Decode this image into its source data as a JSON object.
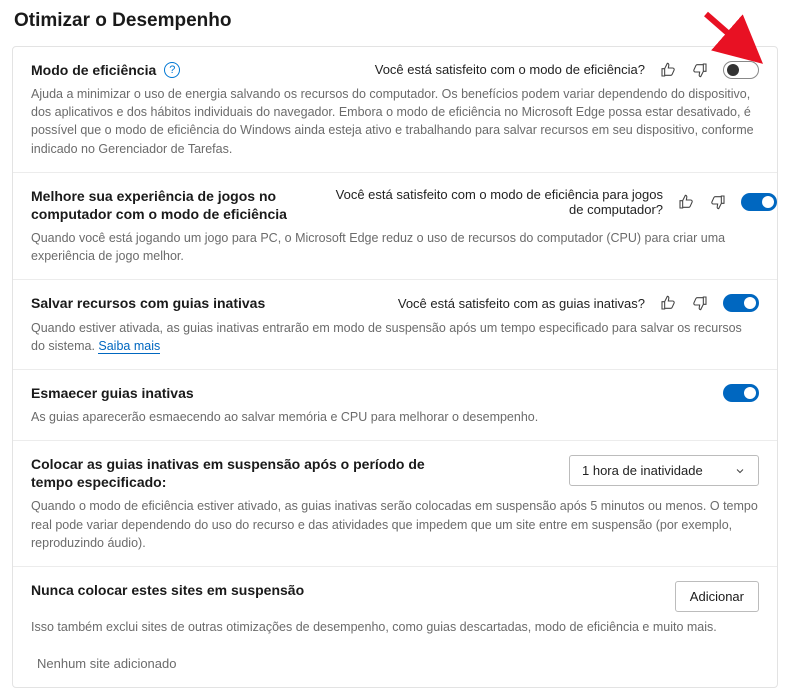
{
  "page_title": "Otimizar o Desempenho",
  "sections": {
    "efficiency": {
      "title": "Modo de eficiência",
      "prompt": "Você está satisfeito com o modo de eficiência?",
      "desc": "Ajuda a minimizar o uso de energia salvando os recursos do computador. Os benefícios podem variar dependendo do dispositivo, dos aplicativos e dos hábitos individuais do navegador. Embora o modo de eficiência no Microsoft Edge possa estar desativado, é possível que o modo de eficiência do Windows ainda esteja ativo e trabalhando para salvar recursos em seu dispositivo, conforme indicado no Gerenciador de Tarefas."
    },
    "gaming": {
      "title": "Melhore sua experiência de jogos no computador com o modo de eficiência",
      "prompt": "Você está satisfeito com o modo de eficiência para jogos de computador?",
      "desc": "Quando você está jogando um jogo para PC, o Microsoft Edge reduz o uso de recursos do computador (CPU) para criar uma experiência de jogo melhor."
    },
    "sleeping": {
      "title": "Salvar recursos com guias inativas",
      "prompt": "Você está satisfeito com as guias inativas?",
      "desc": "Quando estiver ativada, as guias inativas entrarão em modo de suspensão após um tempo especificado para salvar os recursos do sistema. ",
      "learn_more": "Saiba mais"
    },
    "fade": {
      "title": "Esmaecer guias inativas",
      "desc": "As guias aparecerão esmaecendo ao salvar memória e CPU para melhorar o desempenho."
    },
    "timeout": {
      "title": "Colocar as guias inativas em suspensão após o período de tempo especificado:",
      "selected": "1 hora de inatividade",
      "desc": "Quando o modo de eficiência estiver ativado, as guias inativas serão colocadas em suspensão após 5 minutos ou menos. O tempo real pode variar dependendo do uso do recurso e das atividades que impedem que um site entre em suspensão (por exemplo, reproduzindo áudio)."
    },
    "never": {
      "title": "Nunca colocar estes sites em suspensão",
      "add_label": "Adicionar",
      "desc": "Isso também exclui sites de outras otimizações de desempenho, como guias descartadas, modo de eficiência e muito mais.",
      "empty": "Nenhum site adicionado"
    }
  }
}
